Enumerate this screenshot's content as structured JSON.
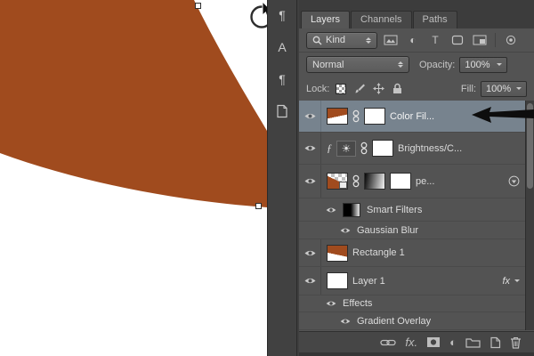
{
  "canvas": {
    "bg": "#ffffff",
    "shape_color": "#a04b1e"
  },
  "dock": {
    "icons": [
      "paragraph-panel",
      "character-panel",
      "character-styles-panel",
      "libraries-panel"
    ]
  },
  "icons": {
    "paragraph": "¶",
    "character": "A",
    "sun": "☀",
    "adjustment": "◐",
    "type": "T",
    "clip": "ƒ",
    "fx": "fx",
    "fx_dot": "fx."
  },
  "panel": {
    "tabs": [
      {
        "label": "Layers",
        "active": true
      },
      {
        "label": "Channels",
        "active": false
      },
      {
        "label": "Paths",
        "active": false
      }
    ],
    "filter": {
      "kind_label": "Kind",
      "icons": [
        "filter-pixel-layers",
        "filter-adjustment-layers",
        "filter-type-layers",
        "filter-shape-layers",
        "filter-smart-objects"
      ]
    },
    "blend": {
      "mode": "Normal",
      "opacity_label": "Opacity:",
      "opacity_value": "100%"
    },
    "lock": {
      "label": "Lock:",
      "icons": [
        "lock-transparent-pixels",
        "lock-image-pixels",
        "lock-position",
        "lock-all"
      ],
      "fill_label": "Fill:",
      "fill_value": "100%"
    },
    "layers": [
      {
        "name": "Color Fil...",
        "type": "color-fill",
        "selected": true,
        "visible": true
      },
      {
        "name": "Brightness/C...",
        "type": "adjustment",
        "visible": true
      },
      {
        "name": "pe...",
        "type": "smart-object",
        "visible": true
      },
      {
        "name": "Smart Filters",
        "type": "smart-filters-group",
        "visible": true
      },
      {
        "name": "Gaussian Blur",
        "type": "smart-filter",
        "visible": true
      },
      {
        "name": "Rectangle 1",
        "type": "shape",
        "visible": true
      },
      {
        "name": "Layer 1",
        "type": "normal",
        "has_fx": true,
        "visible": true
      },
      {
        "name": "Effects",
        "type": "effects-group",
        "visible": true
      },
      {
        "name": "Gradient Overlay",
        "type": "effect",
        "visible": true
      }
    ],
    "bottom_icons": [
      "link-layers",
      "layer-style",
      "add-layer-mask",
      "new-adjustment-layer",
      "new-group",
      "new-layer",
      "delete-layer"
    ]
  }
}
